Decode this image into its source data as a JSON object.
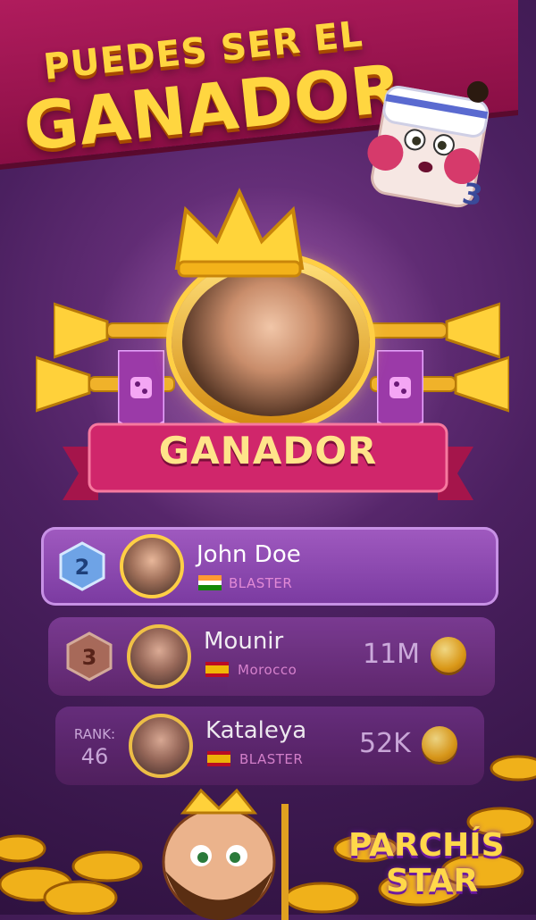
{
  "headline": {
    "line1": "PUEDES SER EL",
    "line2": "GANADOR"
  },
  "winner": {
    "ribbon_label": "GANADOR"
  },
  "leaderboard": [
    {
      "rank": "2",
      "name": "John Doe",
      "sub": "BLASTER",
      "country": "India",
      "score": ""
    },
    {
      "rank": "3",
      "name": "Mounir",
      "sub": "Morocco",
      "country": "Spain",
      "score": "11M"
    },
    {
      "rank_label": "RANK:",
      "rank": "46",
      "name": "Kataleya",
      "sub": "BLASTER",
      "country": "Spain",
      "score": "52K"
    }
  ],
  "logo": {
    "line1": "PARCHÍS",
    "line2": "STAR"
  },
  "colors": {
    "background": "#4b2060",
    "banner": "#9e1652",
    "headline": "#ffd640",
    "ribbon": "#d0266b",
    "row_highlight": "#9a52bb",
    "row_text_sub": "#e28ad6",
    "gold": "#ffcf45"
  },
  "icons": [
    "crown-icon",
    "trumpet-icon",
    "dice-flame-icon",
    "rank-badge-icon",
    "coin-icon",
    "india-flag-icon",
    "spain-flag-icon",
    "dice-mascot",
    "pirate-mascot"
  ]
}
